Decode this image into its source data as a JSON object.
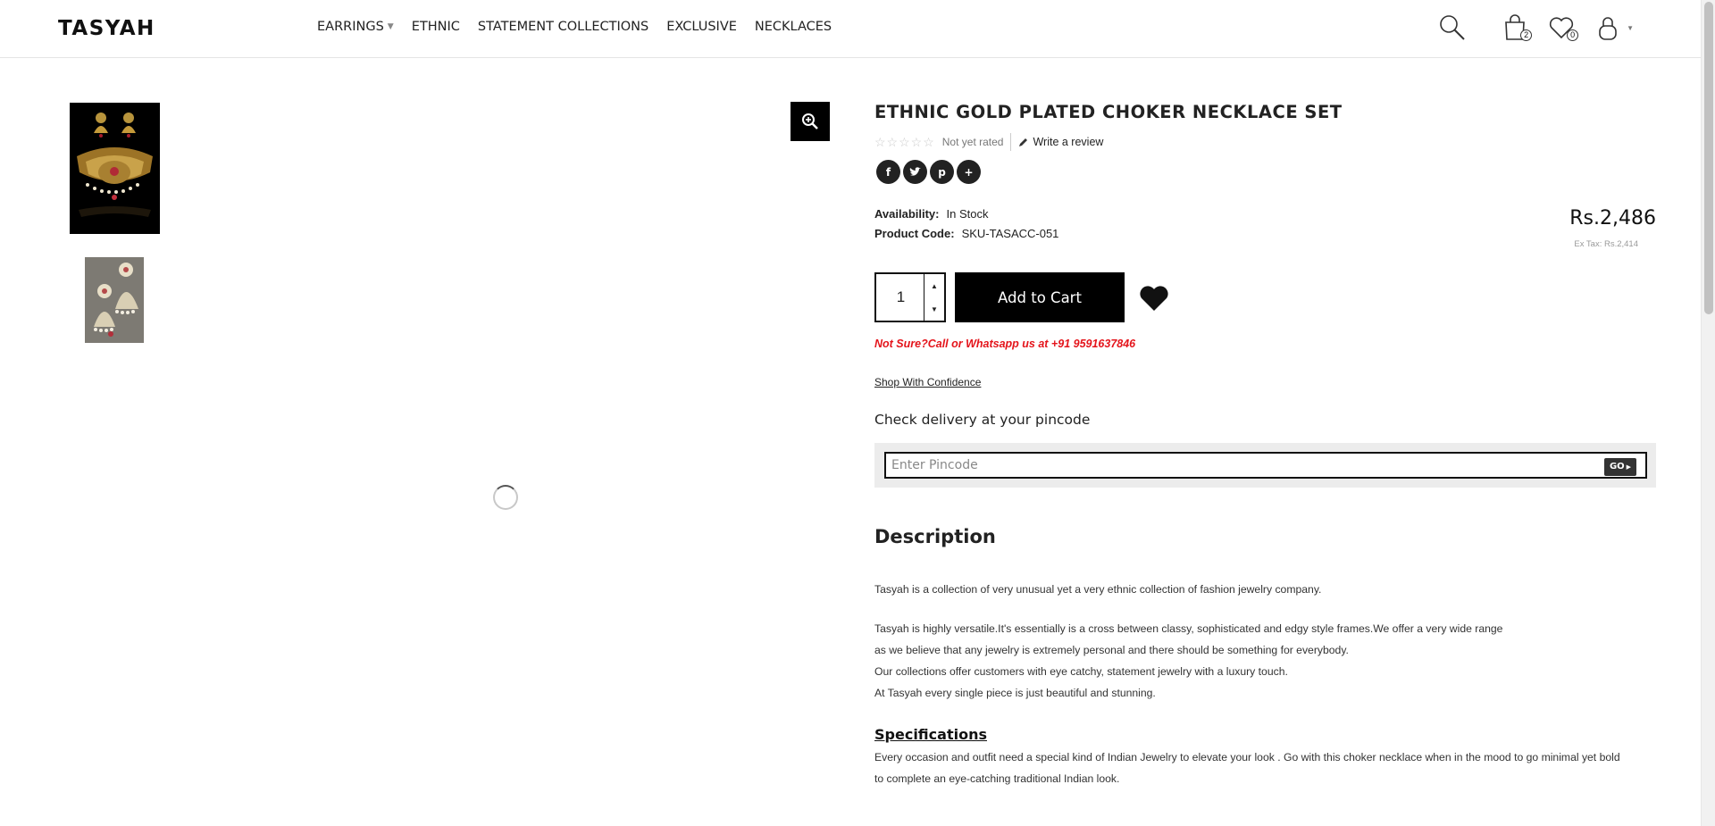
{
  "header": {
    "logo": "TASYAH",
    "nav": [
      {
        "label": "EARRINGS",
        "has_dropdown": true
      },
      {
        "label": "ETHNIC",
        "has_dropdown": false
      },
      {
        "label": "STATEMENT COLLECTIONS",
        "has_dropdown": false
      },
      {
        "label": "EXCLUSIVE",
        "has_dropdown": false
      },
      {
        "label": "NECKLACES",
        "has_dropdown": false
      }
    ],
    "icons": {
      "search": "search-icon",
      "cart": "shopping-bag-icon",
      "wishlist": "heart-icon",
      "account": "user-icon"
    },
    "cart_count": "2",
    "wishlist_count": "0"
  },
  "gallery": {
    "thumbnails": [
      "necklace-set-image",
      "jhumka-earrings-image"
    ],
    "zoom_icon": "zoom-in-icon",
    "loading": true
  },
  "product": {
    "title": "ETHNIC GOLD PLATED CHOKER NECKLACE SET",
    "rating_stars": 0,
    "rating_text": "Not yet rated",
    "write_review": "Write a review",
    "share_icons": [
      "facebook-icon",
      "twitter-icon",
      "pinterest-icon",
      "plus-icon"
    ],
    "availability_label": "Availability:",
    "availability_value": "In Stock",
    "code_label": "Product Code:",
    "code_value": "SKU-TASACC-051",
    "price": "Rs.2,486",
    "ex_tax": "Ex Tax: Rs.2,414",
    "quantity": "1",
    "add_to_cart": "Add to Cart",
    "call_note": "Not Sure?Call or Whatsapp us at +91 9591637846",
    "shop_confidence": "Shop With Confidence",
    "pincode_heading": "Check delivery at your pincode",
    "pincode_placeholder": "Enter Pincode",
    "go_label": "GO"
  },
  "description": {
    "heading": "Description",
    "paragraphs": [
      "Tasyah is a collection of very unusual yet a very ethnic collection of fashion jewelry company.",
      "Tasyah is highly versatile.It's essentially is a cross between classy, sophisticated and edgy style frames.We offer a very wide range",
      "as we believe that any jewelry is extremely personal and there should be something for everybody.",
      "Our collections offer customers with eye catchy, statement jewelry with a luxury touch.",
      "At Tasyah every single piece is just beautiful and stunning."
    ],
    "spec_heading": "Specifications",
    "spec_lines": [
      "Every occasion and outfit need a special kind of Indian Jewelry to elevate your look . Go with this choker necklace when in the mood to go minimal yet bold",
      "to complete an eye-catching traditional Indian look."
    ]
  },
  "colors": {
    "accent": "#000000",
    "alert": "#e4141b"
  }
}
